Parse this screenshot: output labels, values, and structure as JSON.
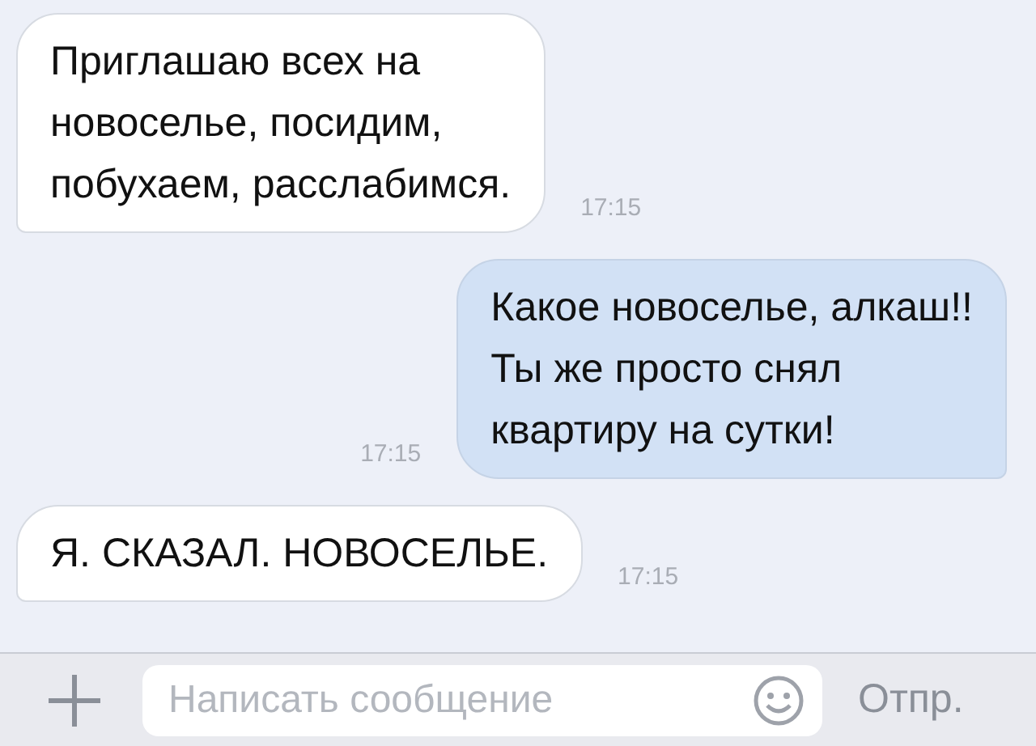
{
  "messages": [
    {
      "kind": "incoming",
      "lines": [
        "Приглашаю всех на",
        "новоселье, посидим,",
        "побухаем, расслабимся."
      ],
      "time": "17:15"
    },
    {
      "kind": "outgoing",
      "lines": [
        "Какое новоселье, алкаш!!",
        "Ты же просто снял",
        "квартиру на сутки!"
      ],
      "time": "17:15"
    },
    {
      "kind": "incoming",
      "lines": [
        "Я. СКАЗАЛ. НОВОСЕЛЬЕ."
      ],
      "time": "17:15"
    }
  ],
  "composer": {
    "placeholder": "Написать сообщение",
    "send": "Отпр."
  }
}
